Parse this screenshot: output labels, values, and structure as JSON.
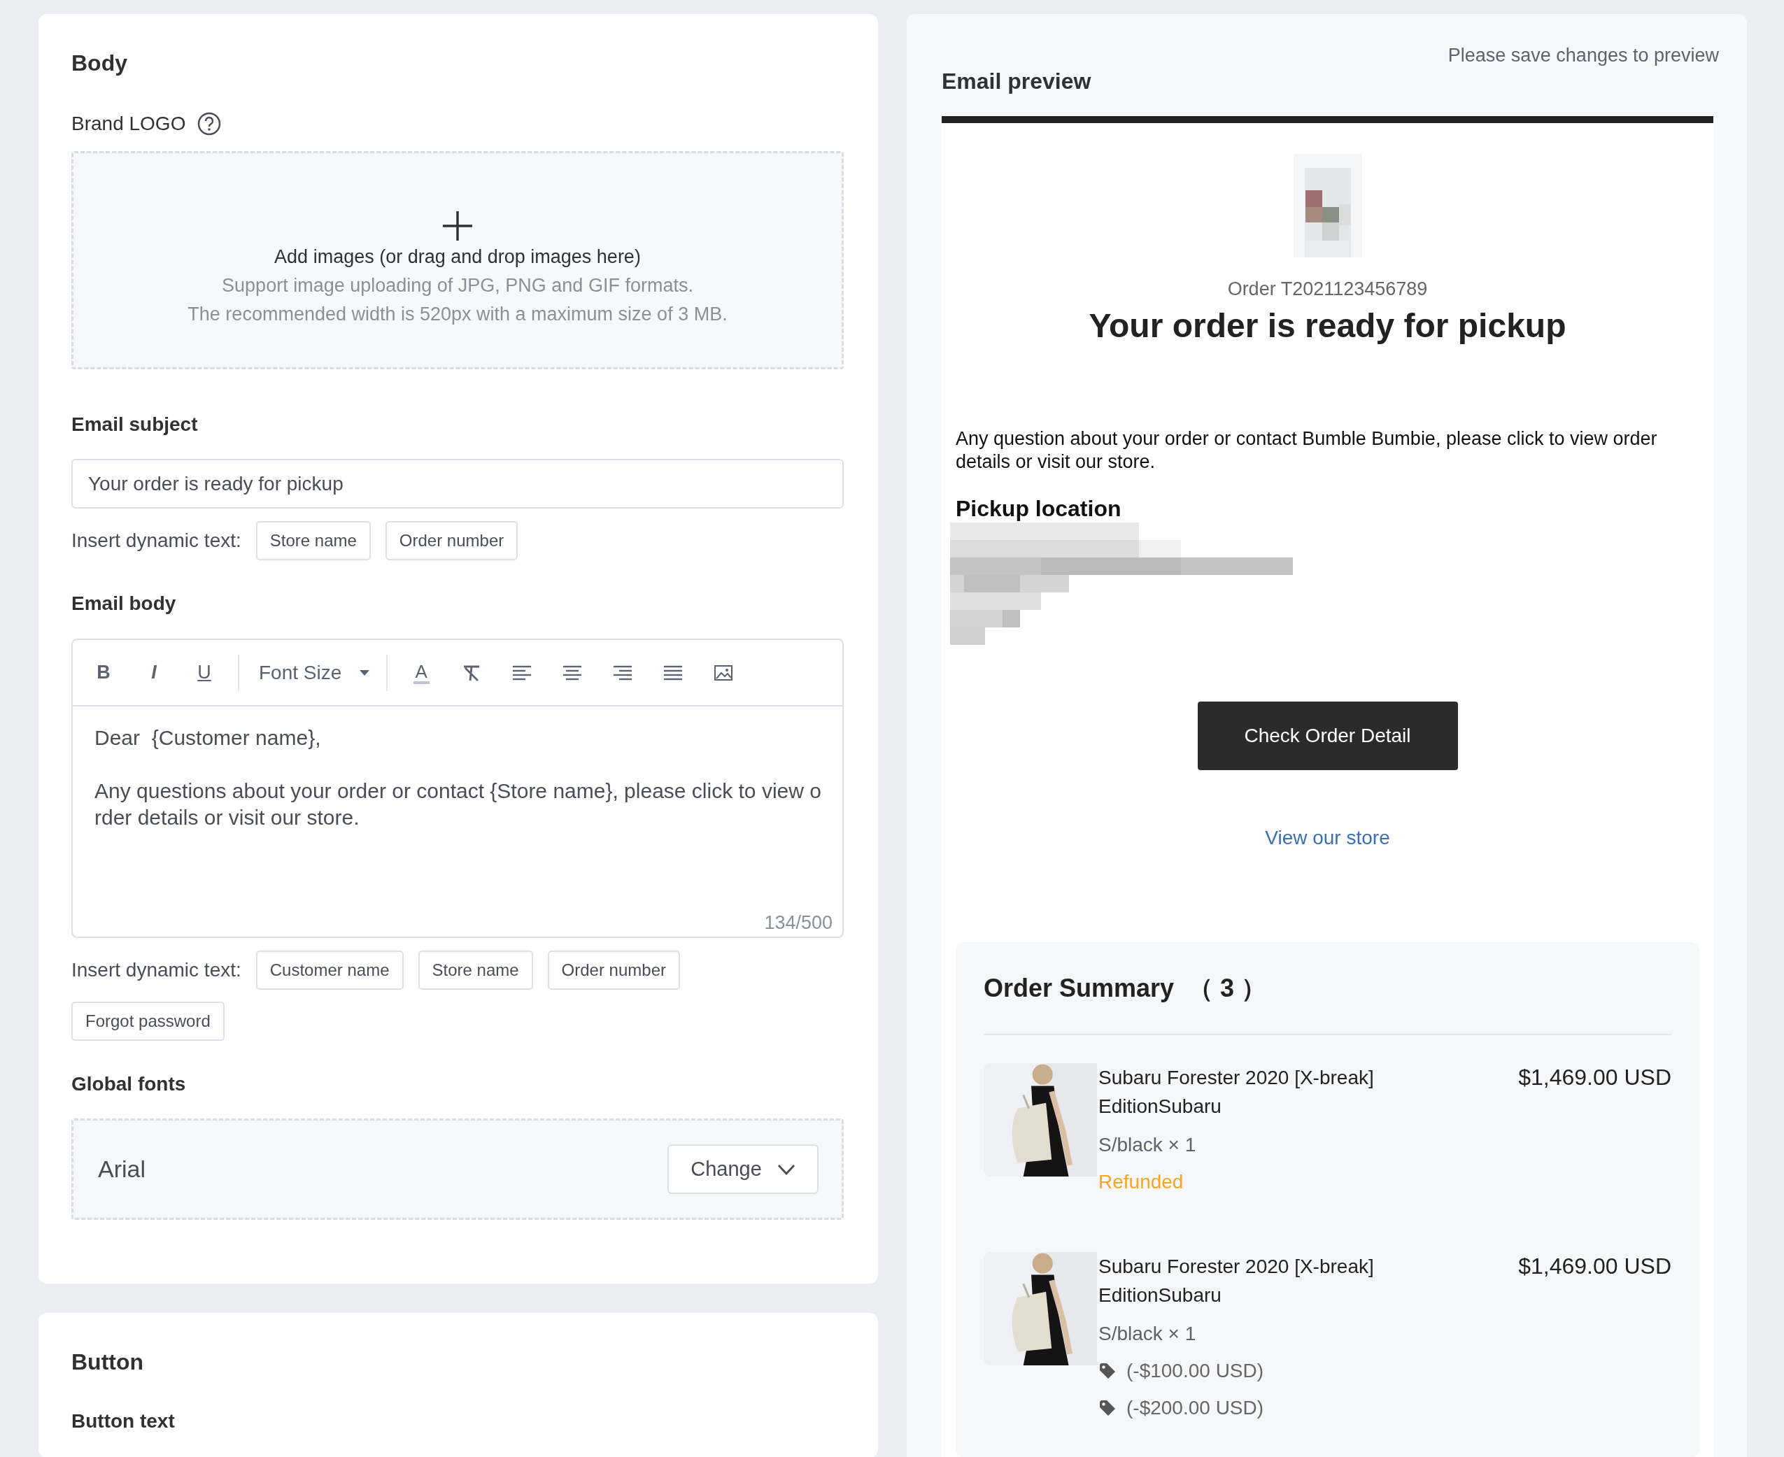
{
  "body_card": {
    "title": "Body",
    "brand_logo_label": "Brand LOGO",
    "upload": {
      "prompt": "Add images (or drag and drop images here)",
      "formats": "Support image uploading of JPG, PNG and GIF formats.",
      "size_hint": "The recommended width is 520px with a maximum size of 3 MB."
    },
    "email_subject": {
      "label": "Email subject",
      "value": "Your order is ready for pickup",
      "insert_label": "Insert dynamic text:",
      "insert_options": [
        "Store name",
        "Order number"
      ]
    },
    "email_body": {
      "label": "Email body",
      "toolbar": {
        "bold": "B",
        "italic": "I",
        "underline": "U",
        "font_size": "Font Size",
        "text_color": "A"
      },
      "paragraphs": [
        "Dear  {Customer name},",
        "Any questions about your order or contact {Store name}, please click to view order details or visit our store."
      ],
      "counter": "134/500",
      "insert_label": "Insert dynamic text:",
      "insert_options": [
        "Customer name",
        "Store name",
        "Order number",
        "Forgot password"
      ]
    },
    "global_fonts": {
      "label": "Global fonts",
      "font": "Arial",
      "change_button": "Change"
    }
  },
  "button_card": {
    "title": "Button",
    "button_text_label": "Button text"
  },
  "preview": {
    "notice": "Please save changes to preview",
    "title": "Email preview",
    "order_number": "Order T2021123456789",
    "heading": "Your order is ready for pickup",
    "message": "Any question about your order or contact Bumble Bumbie, please click to view order details or visit our store.",
    "pickup_title": "Pickup location",
    "check_button": "Check Order Detail",
    "store_link": "View our store",
    "summary": {
      "title": "Order Summary",
      "count": "（ 3 ）",
      "items": [
        {
          "name": "Subaru Forester 2020 [X-break] EditionSubaru",
          "variant": "S/black × 1",
          "price": "$1,469.00 USD",
          "status": "Refunded"
        },
        {
          "name": "Subaru Forester 2020 [X-break] EditionSubaru",
          "variant": "S/black × 1",
          "price": "$1,469.00 USD",
          "discounts": [
            "(-$100.00 USD)",
            "(-$200.00 USD)"
          ]
        }
      ]
    }
  }
}
